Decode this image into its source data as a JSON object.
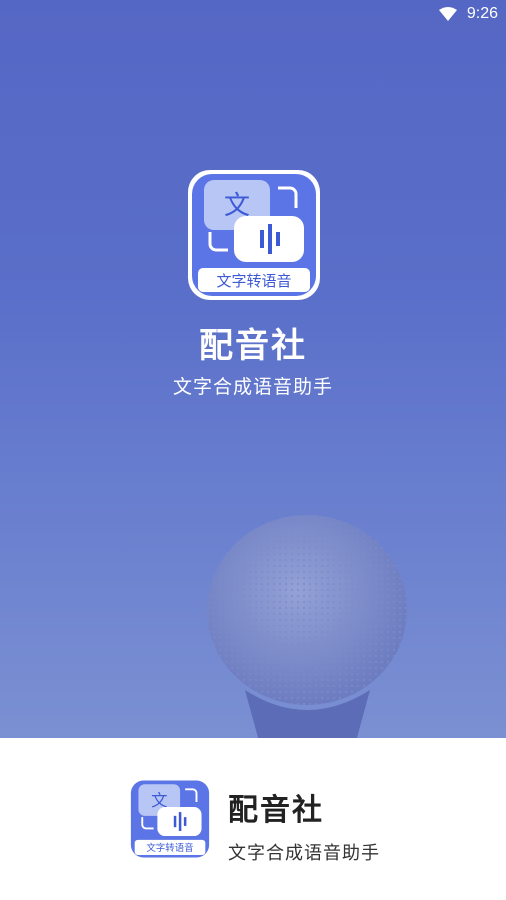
{
  "status_bar": {
    "time": "9:26",
    "wifi_icon": "wifi-icon"
  },
  "splash": {
    "app_name": "配音社",
    "tagline": "文字合成语音助手",
    "background_color": "#5a6fc9",
    "background_image": "microphone-photo"
  },
  "app_icon": {
    "glyph": "文",
    "label": "文字转语音",
    "accent_color": "#5b74e6",
    "icon": "app-logo-icon"
  },
  "footer": {
    "app_name": "配音社",
    "tagline": "文字合成语音助手"
  }
}
